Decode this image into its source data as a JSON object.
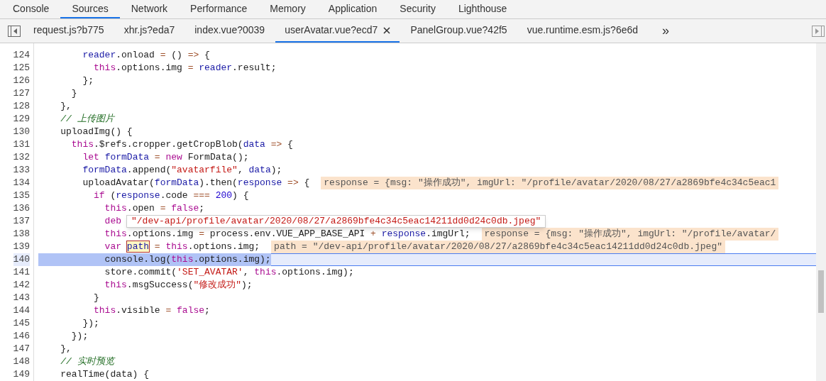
{
  "panel_tabs": [
    {
      "label": "Console",
      "selected": false
    },
    {
      "label": "Sources",
      "selected": true
    },
    {
      "label": "Network",
      "selected": false
    },
    {
      "label": "Performance",
      "selected": false
    },
    {
      "label": "Memory",
      "selected": false
    },
    {
      "label": "Application",
      "selected": false
    },
    {
      "label": "Security",
      "selected": false
    },
    {
      "label": "Lighthouse",
      "selected": false
    }
  ],
  "file_tabs": [
    {
      "label": "request.js?b775",
      "selected": false
    },
    {
      "label": "xhr.js?eda7",
      "selected": false
    },
    {
      "label": "index.vue?0039",
      "selected": false
    },
    {
      "label": "userAvatar.vue?ecd7",
      "selected": true
    },
    {
      "label": "PanelGroup.vue?42f5",
      "selected": false
    },
    {
      "label": "vue.runtime.esm.js?6e6d",
      "selected": false
    }
  ],
  "file_tabs_more": "»",
  "code_lines": [
    {
      "number": "124",
      "selected": false,
      "tokens": [
        {
          "text": "        reader",
          "kind": "var"
        },
        {
          "text": ".onload ",
          "kind": "plain"
        },
        {
          "text": "= ",
          "kind": "op"
        },
        {
          "text": "() ",
          "kind": "plain"
        },
        {
          "text": "=> ",
          "kind": "op"
        },
        {
          "text": "{",
          "kind": "plain"
        }
      ]
    },
    {
      "number": "125",
      "selected": false,
      "tokens": [
        {
          "text": "          this",
          "kind": "kw"
        },
        {
          "text": ".options.img ",
          "kind": "plain"
        },
        {
          "text": "= ",
          "kind": "op"
        },
        {
          "text": "reader",
          "kind": "var"
        },
        {
          "text": ".result;",
          "kind": "plain"
        }
      ]
    },
    {
      "number": "126",
      "selected": false,
      "tokens": [
        {
          "text": "        };",
          "kind": "plain"
        }
      ]
    },
    {
      "number": "127",
      "selected": false,
      "tokens": [
        {
          "text": "      }",
          "kind": "plain"
        }
      ]
    },
    {
      "number": "128",
      "selected": false,
      "tokens": [
        {
          "text": "    },",
          "kind": "plain"
        }
      ]
    },
    {
      "number": "129",
      "selected": false,
      "tokens": [
        {
          "text": "    // 上传图片",
          "kind": "com"
        }
      ]
    },
    {
      "number": "130",
      "selected": false,
      "tokens": [
        {
          "text": "    uploadImg() {",
          "kind": "plain"
        }
      ]
    },
    {
      "number": "131",
      "selected": false,
      "tokens": [
        {
          "text": "      this",
          "kind": "kw"
        },
        {
          "text": ".$refs.cropper.getCropBlob(",
          "kind": "plain"
        },
        {
          "text": "data ",
          "kind": "var"
        },
        {
          "text": "=> ",
          "kind": "op"
        },
        {
          "text": "{",
          "kind": "plain"
        }
      ]
    },
    {
      "number": "132",
      "selected": false,
      "tokens": [
        {
          "text": "        let ",
          "kind": "kw"
        },
        {
          "text": "formData ",
          "kind": "var"
        },
        {
          "text": "= ",
          "kind": "op"
        },
        {
          "text": "new ",
          "kind": "kw"
        },
        {
          "text": "FormData();",
          "kind": "plain"
        }
      ]
    },
    {
      "number": "133",
      "selected": false,
      "tokens": [
        {
          "text": "        formData",
          "kind": "var"
        },
        {
          "text": ".append(",
          "kind": "plain"
        },
        {
          "text": "\"avatarfile\"",
          "kind": "str"
        },
        {
          "text": ", ",
          "kind": "plain"
        },
        {
          "text": "data",
          "kind": "var"
        },
        {
          "text": ");",
          "kind": "plain"
        }
      ]
    },
    {
      "number": "134",
      "selected": false,
      "tokens": [
        {
          "text": "        uploadAvatar(",
          "kind": "plain"
        },
        {
          "text": "formData",
          "kind": "var"
        },
        {
          "text": ").then(",
          "kind": "plain"
        },
        {
          "text": "response ",
          "kind": "var"
        },
        {
          "text": "=> ",
          "kind": "op"
        },
        {
          "text": "{",
          "kind": "plain"
        }
      ],
      "inline_value": "response = {msg: \"操作成功\", imgUrl: \"/profile/avatar/2020/08/27/a2869bfe4c34c5eac1"
    },
    {
      "number": "135",
      "selected": false,
      "tokens": [
        {
          "text": "          if ",
          "kind": "kw"
        },
        {
          "text": "(",
          "kind": "plain"
        },
        {
          "text": "response",
          "kind": "var"
        },
        {
          "text": ".code ",
          "kind": "plain"
        },
        {
          "text": "=== ",
          "kind": "op"
        },
        {
          "text": "200",
          "kind": "num"
        },
        {
          "text": ") {",
          "kind": "plain"
        }
      ]
    },
    {
      "number": "136",
      "selected": false,
      "tokens": [
        {
          "text": "            this",
          "kind": "kw"
        },
        {
          "text": ".open ",
          "kind": "plain"
        },
        {
          "text": "= ",
          "kind": "op"
        },
        {
          "text": "false",
          "kind": "kw"
        },
        {
          "text": ";",
          "kind": "plain"
        }
      ]
    },
    {
      "number": "137",
      "selected": false,
      "tokens": [
        {
          "text": "            deb",
          "kind": "kw"
        }
      ]
    },
    {
      "number": "138",
      "selected": false,
      "tokens": [
        {
          "text": "            this",
          "kind": "kw"
        },
        {
          "text": ".options.img ",
          "kind": "plain"
        },
        {
          "text": "= ",
          "kind": "op"
        },
        {
          "text": "process.env.VUE_APP_BASE_API ",
          "kind": "plain"
        },
        {
          "text": "+ ",
          "kind": "op"
        },
        {
          "text": "response",
          "kind": "var"
        },
        {
          "text": ".imgUrl;",
          "kind": "plain"
        }
      ],
      "inline_value": "response = {msg: \"操作成功\", imgUrl: \"/profile/avatar/"
    },
    {
      "number": "139",
      "selected": false,
      "tokens": [
        {
          "text": "            var ",
          "kind": "kw"
        },
        {
          "text": "path",
          "kind": "hover"
        },
        {
          "text": " = ",
          "kind": "op"
        },
        {
          "text": "this",
          "kind": "kw"
        },
        {
          "text": ".options.img;",
          "kind": "plain"
        }
      ],
      "inline_value": "path = \"/dev-api/profile/avatar/2020/08/27/a2869bfe4c34c5eac14211dd0d24c0db.jpeg\""
    },
    {
      "number": "140",
      "selected": true,
      "tokens": [
        {
          "text": "            console.log(",
          "kind": "plain"
        },
        {
          "text": "this",
          "kind": "kw"
        },
        {
          "text": ".options.img);",
          "kind": "plain"
        }
      ]
    },
    {
      "number": "141",
      "selected": false,
      "tokens": [
        {
          "text": "            store.commit(",
          "kind": "plain"
        },
        {
          "text": "'SET_AVATAR'",
          "kind": "str"
        },
        {
          "text": ", ",
          "kind": "plain"
        },
        {
          "text": "this",
          "kind": "kw"
        },
        {
          "text": ".options.img);",
          "kind": "plain"
        }
      ]
    },
    {
      "number": "142",
      "selected": false,
      "tokens": [
        {
          "text": "            this",
          "kind": "kw"
        },
        {
          "text": ".msgSuccess(",
          "kind": "plain"
        },
        {
          "text": "\"修改成功\"",
          "kind": "str"
        },
        {
          "text": ");",
          "kind": "plain"
        }
      ]
    },
    {
      "number": "143",
      "selected": false,
      "tokens": [
        {
          "text": "          }",
          "kind": "plain"
        }
      ]
    },
    {
      "number": "144",
      "selected": false,
      "tokens": [
        {
          "text": "          this",
          "kind": "kw"
        },
        {
          "text": ".visible ",
          "kind": "plain"
        },
        {
          "text": "= ",
          "kind": "op"
        },
        {
          "text": "false",
          "kind": "kw"
        },
        {
          "text": ";",
          "kind": "plain"
        }
      ]
    },
    {
      "number": "145",
      "selected": false,
      "tokens": [
        {
          "text": "        });",
          "kind": "plain"
        }
      ]
    },
    {
      "number": "146",
      "selected": false,
      "tokens": [
        {
          "text": "      });",
          "kind": "plain"
        }
      ]
    },
    {
      "number": "147",
      "selected": false,
      "tokens": [
        {
          "text": "    },",
          "kind": "plain"
        }
      ]
    },
    {
      "number": "148",
      "selected": false,
      "tokens": [
        {
          "text": "    // 实时预览",
          "kind": "com"
        }
      ]
    },
    {
      "number": "149",
      "selected": false,
      "tokens": [
        {
          "text": "    realTime(data) {",
          "kind": "plain"
        }
      ]
    }
  ],
  "hover_popup": "\"/dev-api/profile/avatar/2020/08/27/a2869bfe4c34c5eac14211dd0d24c0db.jpeg\""
}
